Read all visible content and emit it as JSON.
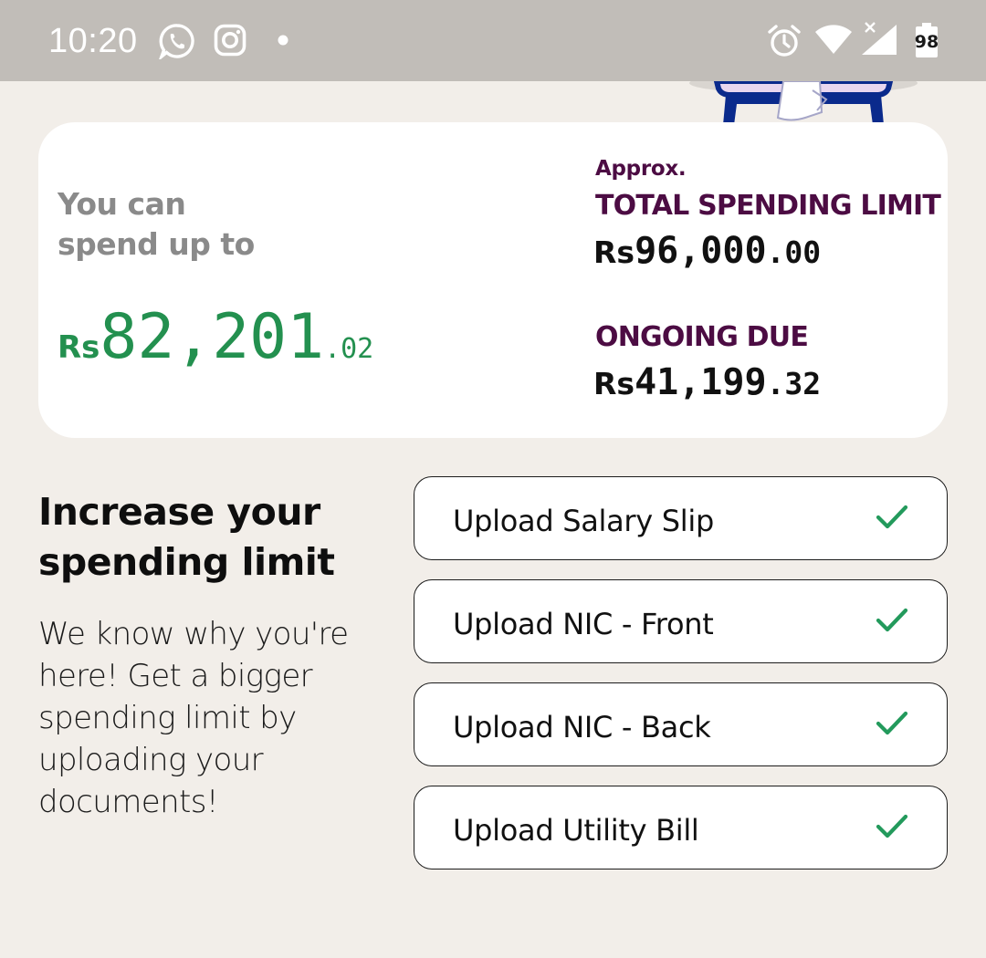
{
  "status_bar": {
    "time": "10:20",
    "battery_level": "98",
    "icons": [
      "whatsapp-icon",
      "instagram-icon",
      "dot-icon",
      "alarm-icon",
      "wifi-icon",
      "signal-icon",
      "battery-icon"
    ]
  },
  "limit_card": {
    "spend_label_line1": "You can",
    "spend_label_line2": "spend up to",
    "spendable": {
      "currency": "Rs",
      "integer": "82,201",
      "decimal": ".02"
    },
    "approx_label": "Approx.",
    "total_limit_label": "TOTAL SPENDING LIMIT",
    "total_limit": {
      "currency": "Rs",
      "integer": "96,000",
      "decimal": ".00"
    },
    "ongoing_due_label": "ONGOING DUE",
    "ongoing_due": {
      "currency": "Rs",
      "integer": "41,199",
      "decimal": ".32"
    }
  },
  "increase": {
    "title_line1": "Increase your",
    "title_line2": "spending limit",
    "description": "We know why you're here! Get a bigger spending limit by uploading your documents!"
  },
  "uploads": [
    {
      "label": "Upload Salary Slip",
      "status_icon": "check-icon"
    },
    {
      "label": "Upload NIC - Front",
      "status_icon": "check-icon"
    },
    {
      "label": "Upload NIC - Back",
      "status_icon": "check-icon"
    },
    {
      "label": "Upload Utility Bill",
      "status_icon": "check-icon"
    }
  ],
  "colors": {
    "background": "#f2eee9",
    "status_bar": "#c1bdb8",
    "spendable_green": "#23904f",
    "label_purple": "#4c0c43",
    "check_green": "#239a5c"
  }
}
